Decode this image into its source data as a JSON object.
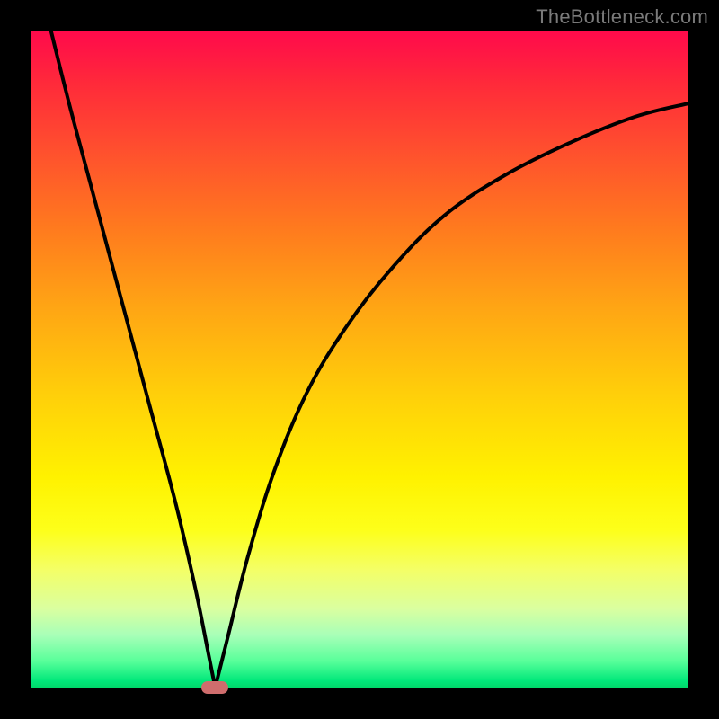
{
  "watermark": "TheBottleneck.com",
  "colors": {
    "frame": "#000000",
    "curve": "#000000",
    "marker": "#cf6d6d",
    "gradient_top": "#ff0a4b",
    "gradient_mid": "#fff200",
    "gradient_bottom": "#00d86a"
  },
  "chart_data": {
    "type": "line",
    "title": "",
    "xlabel": "",
    "ylabel": "",
    "x_range": [
      0,
      100
    ],
    "y_range": [
      0,
      100
    ],
    "grid": false,
    "legend": false,
    "annotation": "Marker at curve minimum (~x=28, y=0)",
    "series": [
      {
        "name": "left-branch",
        "x": [
          3,
          6,
          10,
          14,
          18,
          22,
          25,
          27,
          28
        ],
        "y": [
          100,
          88,
          73,
          58,
          43,
          28,
          15,
          5,
          0
        ]
      },
      {
        "name": "right-branch",
        "x": [
          28,
          30,
          33,
          37,
          42,
          48,
          55,
          63,
          72,
          82,
          92,
          100
        ],
        "y": [
          0,
          8,
          20,
          33,
          45,
          55,
          64,
          72,
          78,
          83,
          87,
          89
        ]
      }
    ],
    "marker": {
      "x": 28,
      "y": 0
    }
  }
}
